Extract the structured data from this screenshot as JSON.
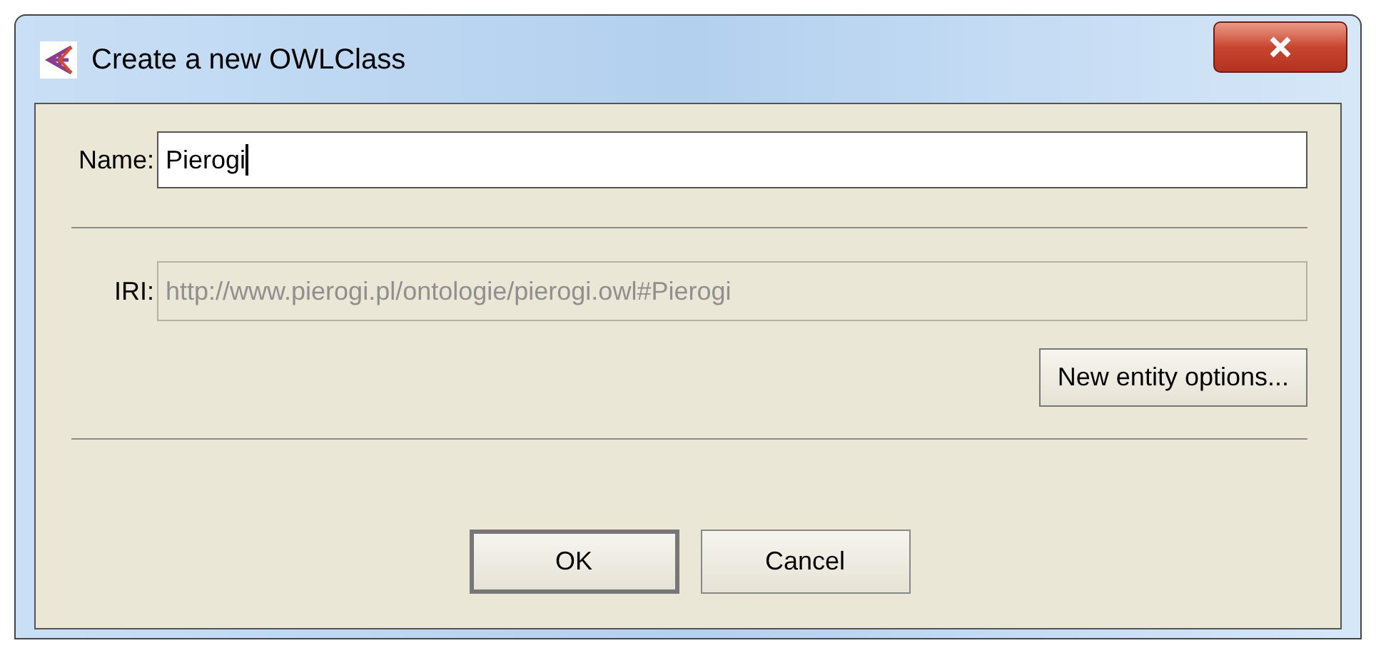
{
  "window": {
    "title": "Create a new OWLClass"
  },
  "name_field": {
    "label": "Name:",
    "value": "Pierogi",
    "focused": true
  },
  "iri_field": {
    "label": "IRI:",
    "value": "http://www.pierogi.pl/ontologie/pierogi.owl#Pierogi",
    "disabled": true
  },
  "options_button": {
    "label": "New entity options..."
  },
  "buttons": [
    {
      "label": "OK",
      "default": true
    },
    {
      "label": "Cancel",
      "default": false
    }
  ]
}
